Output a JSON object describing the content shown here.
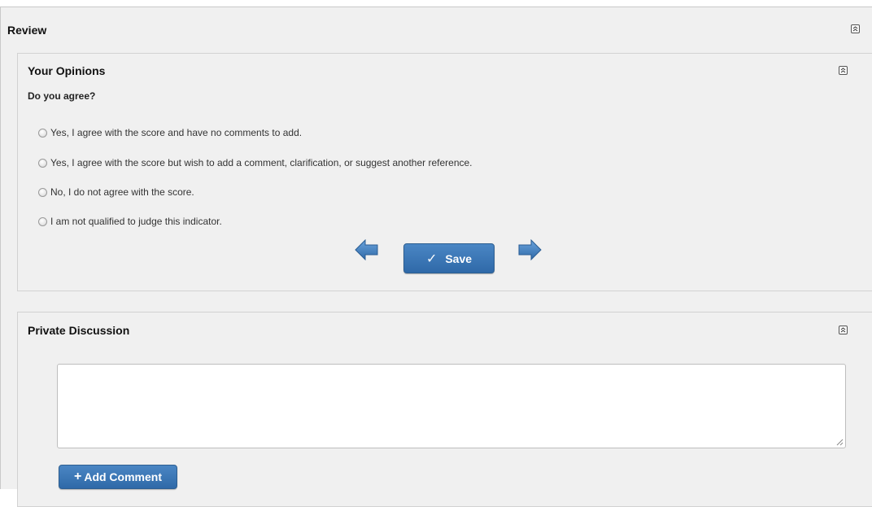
{
  "review": {
    "title": "Review"
  },
  "opinions": {
    "title": "Your Opinions",
    "question": "Do you agree?",
    "options": [
      {
        "label": "Yes, I agree with the score and have no comments to add."
      },
      {
        "label": "Yes, I agree with the score but wish to add a comment, clarification, or suggest another reference."
      },
      {
        "label": "No, I do not agree with the score."
      },
      {
        "label": "I am not qualified to judge this indicator."
      }
    ],
    "save_label": "Save",
    "prev_icon": "arrow-left-icon",
    "next_icon": "arrow-right-icon"
  },
  "discussion": {
    "title": "Private Discussion",
    "comment_value": "",
    "comment_placeholder": "",
    "add_comment_label": "Add Comment"
  },
  "colors": {
    "button_blue": "#3a76b6",
    "arrow_blue": "#3f7fc2",
    "panel_bg": "#f0f0f0"
  }
}
